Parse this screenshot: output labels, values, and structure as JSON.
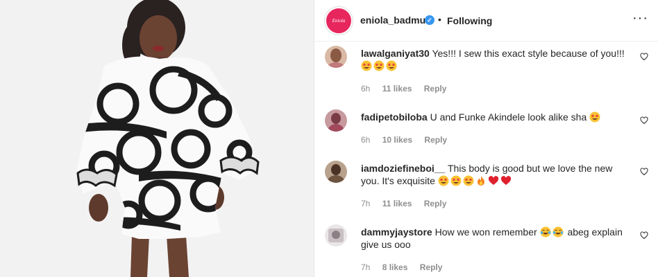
{
  "post": {
    "owner": {
      "username": "eniola_badmus",
      "avatar_text": "Eniola",
      "follow_status": "Following",
      "separator": "•"
    },
    "accent_color": "#e8265e",
    "verified_color": "#3897f0"
  },
  "comments": [
    {
      "username": "lawalganiyat30",
      "text": "Yes!!! I sew this exact style because of you!!!",
      "emoji": [
        "star-struck",
        "star-struck",
        "star-struck"
      ],
      "time": "6h",
      "likes": "11 likes",
      "reply": "Reply"
    },
    {
      "username": "fadipetobiloba",
      "text": "U and Funke Akindele look alike sha",
      "emoji": [
        "star-struck"
      ],
      "time": "6h",
      "likes": "10 likes",
      "reply": "Reply"
    },
    {
      "username": "iamdoziefineboi__",
      "text": "This body is good but we love the new you. It's exquisite",
      "emoji": [
        "star-struck",
        "star-struck",
        "star-struck",
        "fire",
        "red-heart",
        "red-heart"
      ],
      "time": "7h",
      "likes": "11 likes",
      "reply": "Reply"
    },
    {
      "username": "dammyjaystore",
      "text": "How we won remember",
      "text_after": "abeg explain give us ooo",
      "emoji": [
        "laughing-tears",
        "laughing-tears"
      ],
      "time": "7h",
      "likes": "8 likes",
      "reply": "Reply"
    }
  ]
}
